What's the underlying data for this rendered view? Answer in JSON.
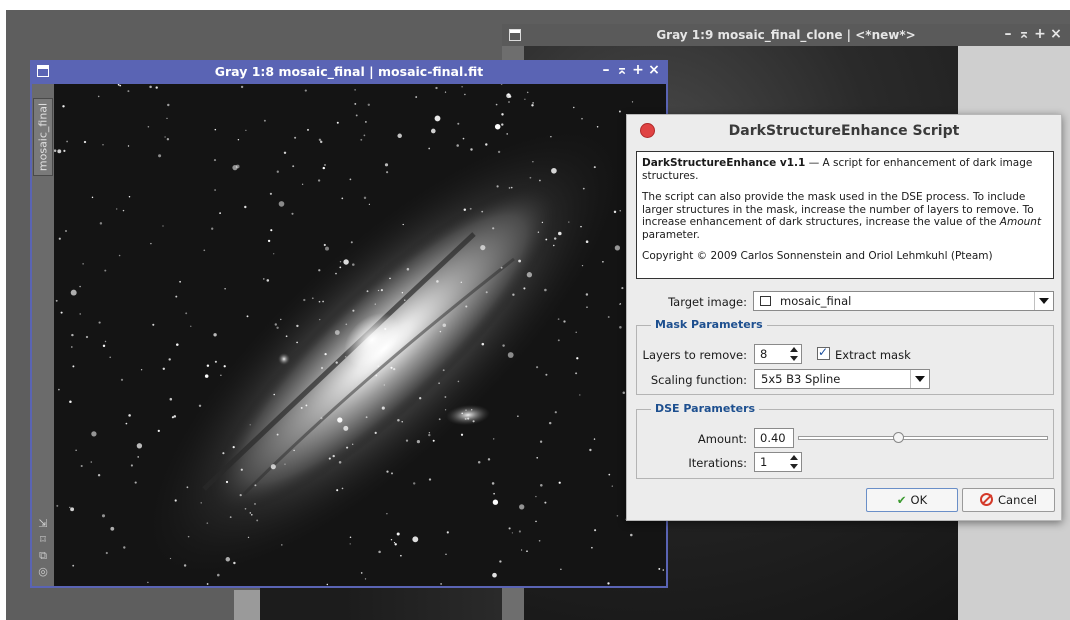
{
  "back_window": {
    "title": "Gray 1:9 mosaic_final_clone | <*new*>",
    "controls": [
      "–",
      "⌅",
      "+",
      "×"
    ]
  },
  "main_window": {
    "title": "Gray 1:8 mosaic_final | mosaic-final.fit",
    "controls": [
      "–",
      "⌅",
      "+",
      "×"
    ],
    "view_tab": "mosaic_final"
  },
  "dialog": {
    "title": "DarkStructureEnhance Script",
    "info": {
      "heading": "DarkStructureEnhance v1.1",
      "heading_rest": " — A script for enhancement of dark image structures.",
      "para2": "The script can also provide the mask used in the DSE process. To include larger structures in the mask, increase the number of layers to remove. To increase enhancement of dark structures, increase the value of the",
      "para2_italic": "Amount",
      "para2_end": " parameter.",
      "copyright": "Copyright © 2009 Carlos Sonnenstein and Oriol Lehmkuhl (Pteam)"
    },
    "target_image_label": "Target image:",
    "target_image_value": "mosaic_final",
    "mask_group_title": "Mask Parameters",
    "layers_label": "Layers to remove:",
    "layers_value": "8",
    "extract_mask_label": "Extract mask",
    "extract_mask_checked": true,
    "scaling_label": "Scaling function:",
    "scaling_value": "5x5 B3 Spline",
    "dse_group_title": "DSE Parameters",
    "amount_label": "Amount:",
    "amount_value": "0.40",
    "amount_slider_fraction": 0.4,
    "iterations_label": "Iterations:",
    "iterations_value": "1",
    "ok_label": "OK",
    "cancel_label": "Cancel"
  },
  "colors": {
    "active_titlebar": "#5a64b4",
    "inactive_titlebar": "#5a5a5a",
    "group_title": "#1d4f8f",
    "close_dot": "#e04343"
  }
}
